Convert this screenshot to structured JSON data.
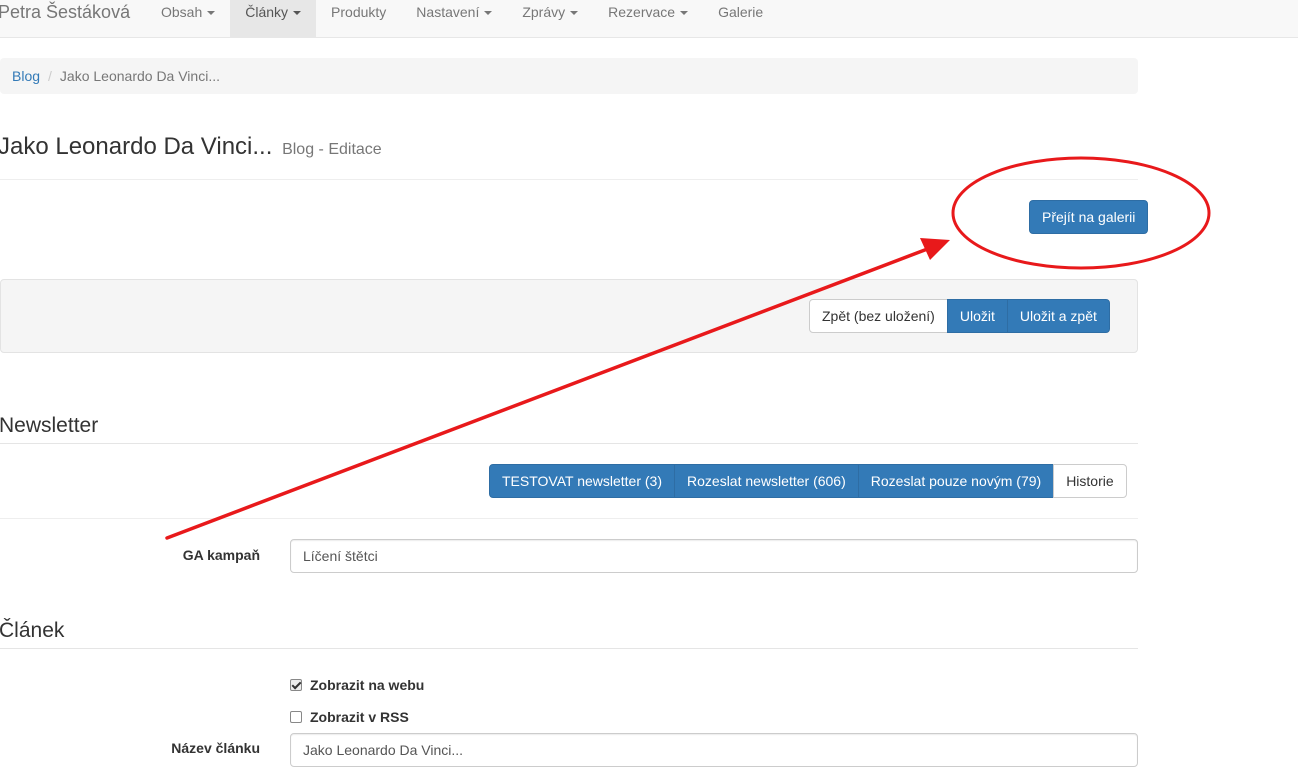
{
  "navbar": {
    "brand": "Petra Šestáková",
    "items": [
      {
        "label": "Obsah",
        "dropdown": true,
        "active": false
      },
      {
        "label": "Články",
        "dropdown": true,
        "active": true
      },
      {
        "label": "Produkty",
        "dropdown": false,
        "active": false
      },
      {
        "label": "Nastavení",
        "dropdown": true,
        "active": false
      },
      {
        "label": "Zprávy",
        "dropdown": true,
        "active": false
      },
      {
        "label": "Rezervace",
        "dropdown": true,
        "active": false
      },
      {
        "label": "Galerie",
        "dropdown": false,
        "active": false
      }
    ]
  },
  "breadcrumb": {
    "link": "Blog",
    "separator": "/",
    "current": "Jako Leonardo Da Vinci..."
  },
  "page": {
    "title": "Jako Leonardo Da Vinci...",
    "subtitle": "Blog - Editace"
  },
  "gallery_button": "Přejít na galerii",
  "save_toolbar": {
    "back": "Zpět (bez uložení)",
    "save": "Uložit",
    "save_back": "Uložit a zpět"
  },
  "newsletter": {
    "legend": "Newsletter",
    "test": "TESTOVAT newsletter (3)",
    "send": "Rozeslat newsletter (606)",
    "send_new": "Rozeslat pouze novým (79)",
    "history": "Historie",
    "ga_label": "GA kampaň",
    "ga_value": "Líčení štětci"
  },
  "article": {
    "legend": "Článek",
    "show_web_label": "Zobrazit na webu",
    "show_web_checked": true,
    "show_rss_label": "Zobrazit v RSS",
    "show_rss_checked": false,
    "name_label": "Název článku",
    "name_value": "Jako Leonardo Da Vinci..."
  },
  "colors": {
    "primary": "#337ab7",
    "annotation": "#e8191b"
  }
}
